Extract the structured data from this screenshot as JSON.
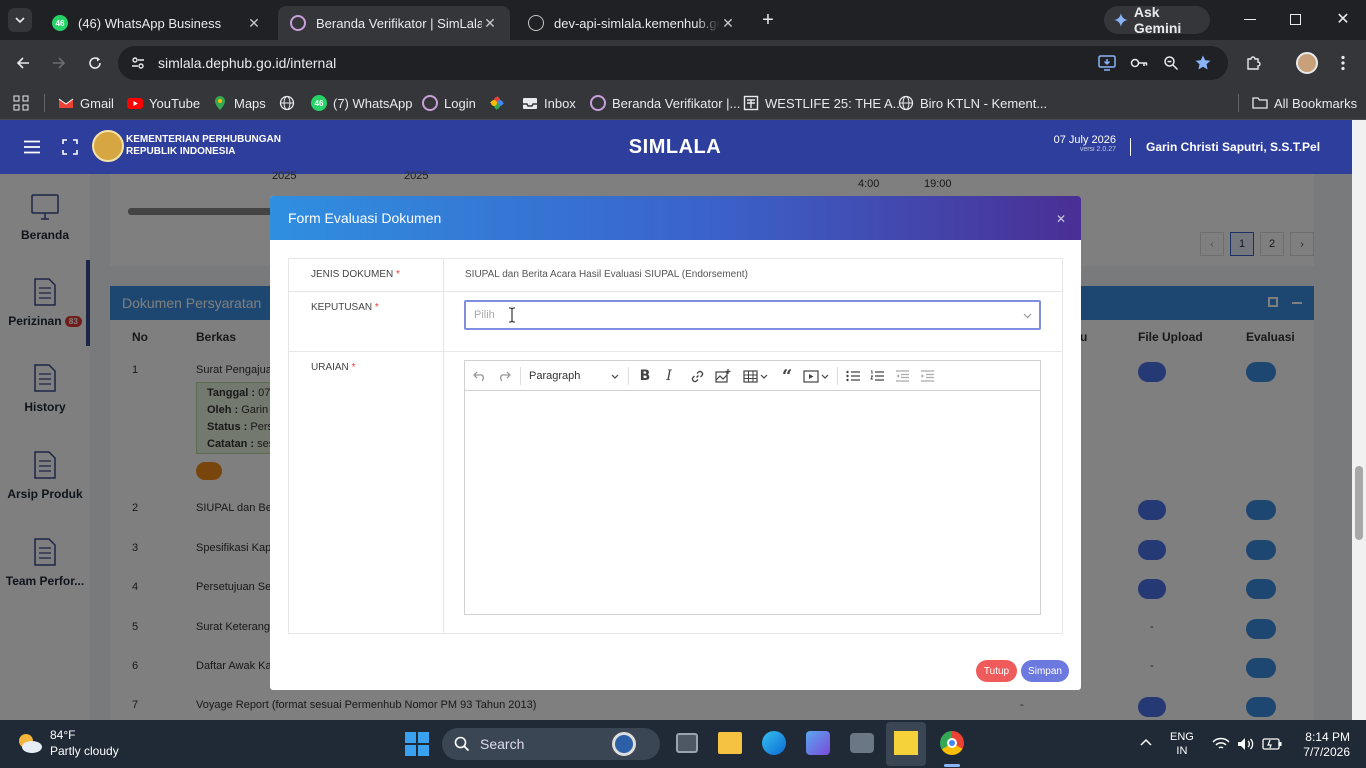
{
  "browser": {
    "tabs": [
      {
        "title": "(46) WhatsApp Business",
        "badge": "46"
      },
      {
        "title": "Beranda Verifikator | SimLala"
      },
      {
        "title": "dev-api-simlala.kemenhub.go.id"
      }
    ],
    "ask_gemini": "Ask Gemini",
    "url": "simlala.dephub.go.id/internal",
    "bookmarks": [
      {
        "label": "Gmail",
        "icon": "gmail-icon"
      },
      {
        "label": "YouTube",
        "icon": "youtube-icon"
      },
      {
        "label": "Maps",
        "icon": "maps-icon"
      },
      {
        "label": "",
        "icon": "globe-icon"
      },
      {
        "label": "(7) WhatsApp",
        "icon": "whatsapp-icon",
        "badge": "46"
      },
      {
        "label": "Login",
        "icon": "site-icon"
      },
      {
        "label": "",
        "icon": "pinwheel-icon"
      },
      {
        "label": "Inbox",
        "icon": "inbox-icon"
      },
      {
        "label": "Beranda Verifikator |...",
        "icon": "site-icon"
      },
      {
        "label": "WESTLIFE 25: THE A...",
        "icon": "document-icon"
      },
      {
        "label": "Biro KTLN - Kement...",
        "icon": "globe-icon"
      }
    ],
    "all_bookmarks": "All Bookmarks"
  },
  "app": {
    "org_line1": "KEMENTERIAN PERHUBUNGAN",
    "org_line2": "REPUBLIK INDONESIA",
    "title": "SIMLALA",
    "date": "07 July 2026",
    "version": "versi 2.0.27",
    "user": "Garin Christi Saputri, S.S.T.Pel",
    "sidebar": [
      {
        "label": "Beranda",
        "icon": "monitor-icon"
      },
      {
        "label": "Perizinan",
        "icon": "document-icon",
        "badge": "83"
      },
      {
        "label": "History",
        "icon": "document-icon"
      },
      {
        "label": "Arsip Produk",
        "icon": "document-icon"
      },
      {
        "label": "Team Perfor...",
        "icon": "document-icon"
      }
    ],
    "upper_table": {
      "years": [
        "2025",
        "2025"
      ],
      "times": [
        "4:00",
        "19:00"
      ],
      "pages": [
        "1",
        "2"
      ]
    },
    "panel_title": "Dokumen Persyaratan",
    "columns": {
      "no": "No",
      "berkas": "Berkas",
      "col_u": "u",
      "file_upload": "File Upload",
      "evaluasi": "Evaluasi"
    },
    "rows": [
      {
        "no": "1",
        "berkas": "Surat Pengajuan"
      },
      {
        "no": "2",
        "berkas": "SIUPAL dan Beri"
      },
      {
        "no": "3",
        "berkas": "Spesifikasi Kapa"
      },
      {
        "no": "4",
        "berkas": "Persetujuan Seb"
      },
      {
        "no": "5",
        "berkas": "Surat Keterangan",
        "dash": "-"
      },
      {
        "no": "6",
        "berkas": "Daftar Awak Kap",
        "dash": "-"
      },
      {
        "no": "7",
        "berkas": "Voyage Report (format sesuai Permenhub Nomor PM 93 Tahun 2013)",
        "dash": "-"
      }
    ],
    "row1_note": {
      "tanggal_label": "Tanggal :",
      "tanggal_val": "07",
      "oleh_label": "Oleh :",
      "oleh_val": "Garin C",
      "status_label": "Status :",
      "status_val": "Perse",
      "catatan_label": "Catatan :",
      "catatan_val": "ses"
    }
  },
  "modal": {
    "title": "Form Evaluasi Dokumen",
    "jenis_label": "JENIS DOKUMEN",
    "jenis_value": "SIUPAL dan Berita Acara Hasil Evaluasi SIUPAL (Endorsement)",
    "keputusan_label": "KEPUTUSAN",
    "keputusan_placeholder": "Pilih",
    "uraian_label": "URAIAN",
    "required_mark": "*",
    "editor": {
      "paragraph": "Paragraph"
    },
    "tutup": "Tutup",
    "simpan": "Simpan"
  },
  "taskbar": {
    "temp": "84°F",
    "weather": "Partly cloudy",
    "search": "Search",
    "lang1": "ENG",
    "lang2": "IN",
    "time": "8:14 PM",
    "date": "7/7/2026"
  }
}
